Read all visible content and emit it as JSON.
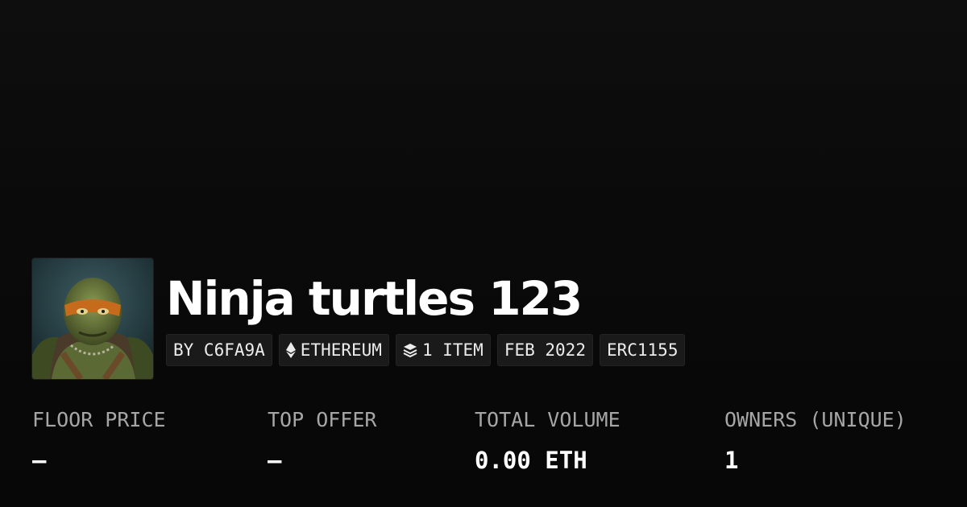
{
  "collection": {
    "name": "Ninja turtles 123",
    "avatar_alt": "turtle portrait"
  },
  "badges": [
    {
      "text": "BY C6FA9A",
      "icon": ""
    },
    {
      "text": "ETHEREUM",
      "icon": "ethereum-icon"
    },
    {
      "text": "1 ITEM",
      "icon": "layers-icon"
    },
    {
      "text": "FEB 2022",
      "icon": ""
    },
    {
      "text": "ERC1155",
      "icon": ""
    }
  ],
  "stats": [
    {
      "label": "FLOOR PRICE",
      "value": "—"
    },
    {
      "label": "TOP OFFER",
      "value": "—"
    },
    {
      "label": "TOTAL VOLUME",
      "value": "0.00 ETH"
    },
    {
      "label": "OWNERS (UNIQUE)",
      "value": "1"
    }
  ],
  "colors": {
    "background": "#0a0a0a",
    "badge_background": "#1a1a1a",
    "label": "#a6a6a6",
    "text": "#ffffff"
  }
}
